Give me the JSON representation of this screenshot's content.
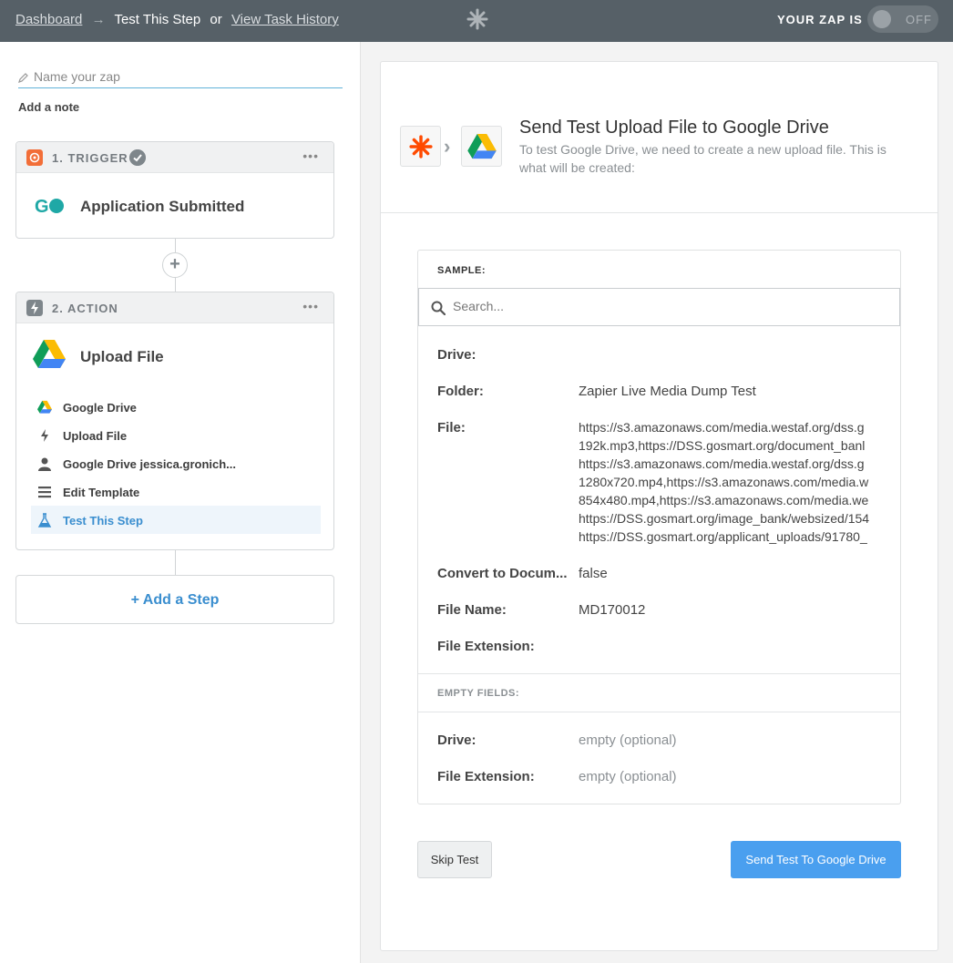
{
  "colors": {
    "topbar": "#566067",
    "accent_blue": "#3a8ecf",
    "button_blue": "#4a9fef",
    "zapier_orange": "#ff4a00"
  },
  "topbar": {
    "crumb_dashboard": "Dashboard",
    "crumb_arrow": "→",
    "crumb_current": "Test This Step",
    "crumb_or": "or",
    "crumb_history": "View Task History",
    "zap_status_label": "YOUR ZAP IS",
    "toggle_label": "OFF",
    "toggle_state": "off"
  },
  "left": {
    "name_placeholder": "Name your zap",
    "add_note": "Add a note",
    "trigger": {
      "title": "1. TRIGGER",
      "menu": "•••",
      "app_name": "Application Submitted",
      "icon": "gosmart-logo"
    },
    "add_between": "+",
    "action": {
      "title": "2. ACTION",
      "menu": "•••",
      "app_name": "Upload File",
      "icon": "google-drive-icon",
      "items": [
        {
          "label": "Google Drive",
          "icon": "google-drive-icon"
        },
        {
          "label": "Upload File",
          "icon": "bolt-icon"
        },
        {
          "label": "Google Drive jessica.gronich...",
          "icon": "user-icon"
        },
        {
          "label": "Edit Template",
          "icon": "lines-icon"
        },
        {
          "label": "Test This Step",
          "icon": "flask-icon",
          "active": true
        }
      ]
    },
    "add_step": "+ Add a Step"
  },
  "main": {
    "title": "Send Test Upload File to Google Drive",
    "description": "To test Google Drive, we need to create a new upload file. This is what will be created:",
    "sample_label": "SAMPLE:",
    "search_placeholder": "Search...",
    "fields": [
      {
        "key": "Drive:",
        "value": ""
      },
      {
        "key": "Folder:",
        "value": "Zapier Live Media Dump Test"
      },
      {
        "key": "File:",
        "value": ""
      },
      {
        "key": "Convert to Docum...",
        "value": "false"
      },
      {
        "key": "File Name:",
        "value": "MD170012"
      },
      {
        "key": "File Extension:",
        "value": ""
      }
    ],
    "file_lines": [
      "https://s3.amazonaws.com/media.westaf.org/dss.g",
      "192k.mp3,https://DSS.gosmart.org/document_banl",
      "https://s3.amazonaws.com/media.westaf.org/dss.g",
      "1280x720.mp4,https://s3.amazonaws.com/media.w",
      "854x480.mp4,https://s3.amazonaws.com/media.we",
      "https://DSS.gosmart.org/image_bank/websized/154",
      "https://DSS.gosmart.org/applicant_uploads/91780_"
    ],
    "empty_label": "EMPTY FIELDS:",
    "empty_fields": [
      {
        "key": "Drive:",
        "value": "empty (optional)"
      },
      {
        "key": "File Extension:",
        "value": "empty (optional)"
      }
    ],
    "skip_button": "Skip Test",
    "send_button": "Send Test To Google Drive"
  }
}
